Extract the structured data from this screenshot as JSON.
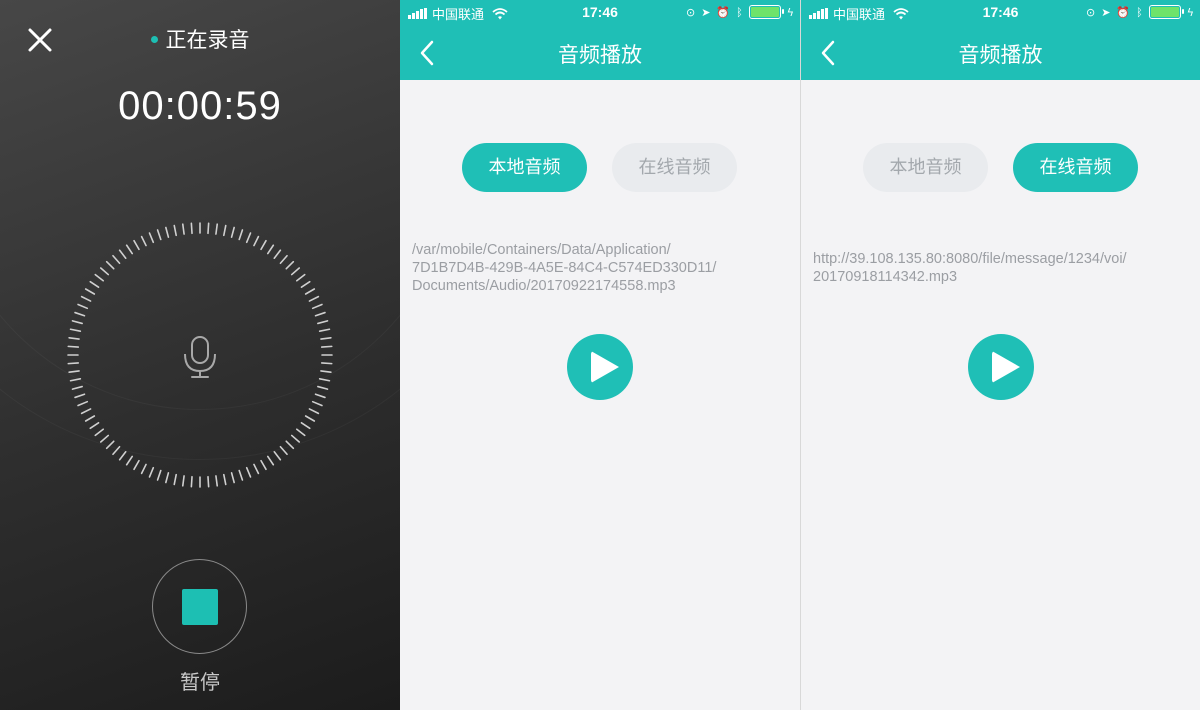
{
  "recording": {
    "status_text": "正在录音",
    "timer": "00:00:59",
    "stop_label": "暂停",
    "accent_color": "#1dbfb3"
  },
  "status_bar": {
    "carrier": "中国联通",
    "time": "17:46"
  },
  "player": {
    "title": "音频播放",
    "tab_local": "本地音频",
    "tab_online": "在线音频",
    "accent_color": "#1fbfb6",
    "local_path_lines": [
      "/var/mobile/Containers/Data/Application/",
      "7D1B7D4B-429B-4A5E-84C4-C574ED330D11/",
      "Documents/Audio/20170922174558.mp3"
    ],
    "online_url_lines": [
      "http://39.108.135.80:8080/file/message/1234/voi/",
      "20170918114342.mp3"
    ]
  },
  "icons": {
    "close": "close-icon",
    "mic": "microphone-icon",
    "stop": "stop-icon",
    "back": "chevron-left-icon",
    "play": "play-icon",
    "wifi": "wifi-icon",
    "battery": "battery-icon"
  }
}
